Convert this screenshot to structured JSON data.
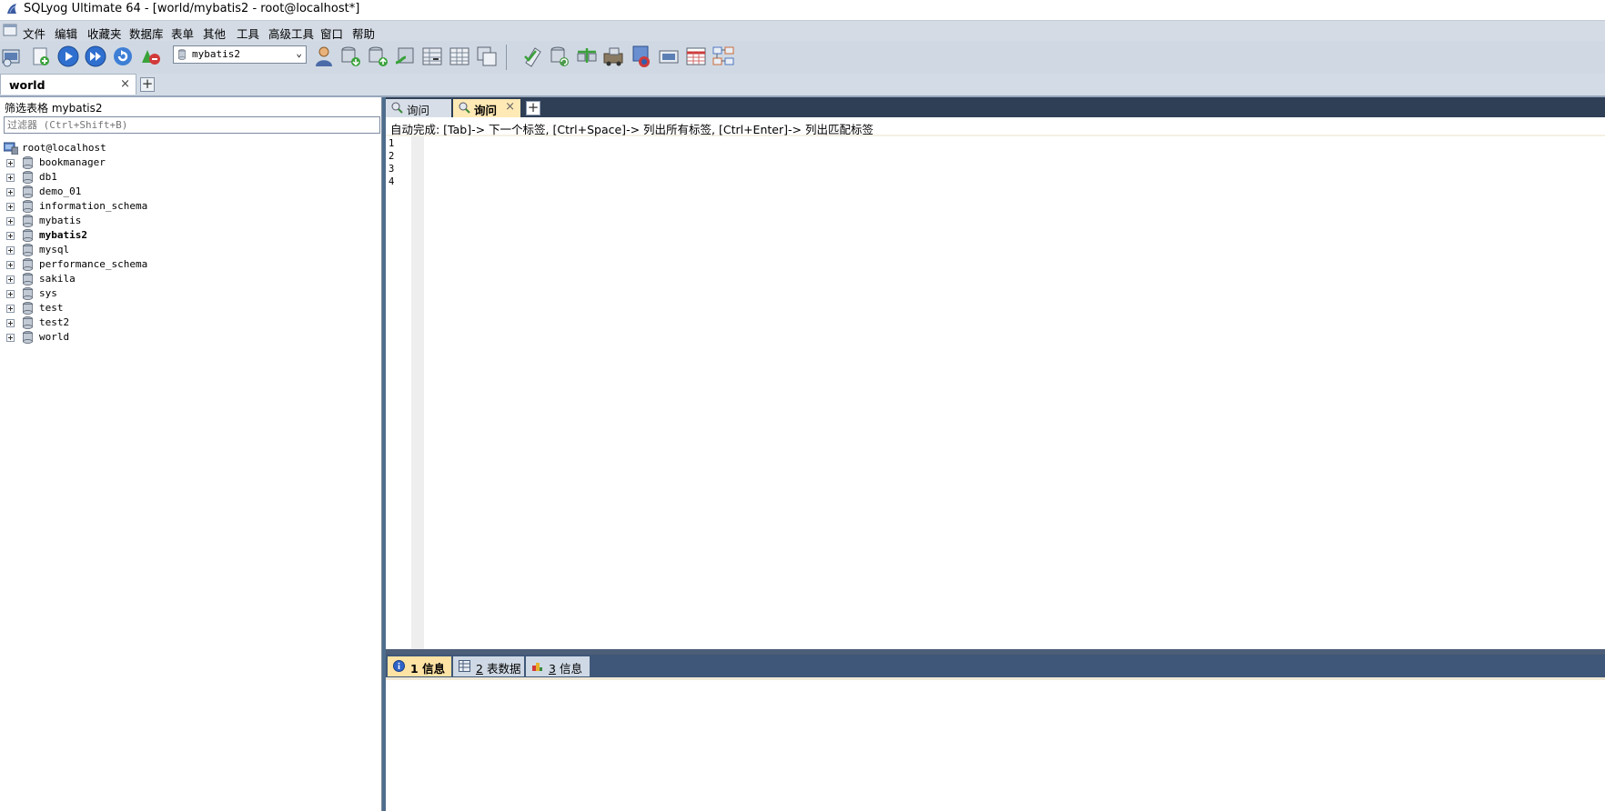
{
  "window": {
    "title": "SQLyog Ultimate 64 - [world/mybatis2 - root@localhost*]"
  },
  "menu": [
    {
      "label": "文件"
    },
    {
      "label": "编辑"
    },
    {
      "label": "收藏夹"
    },
    {
      "label": "数据库"
    },
    {
      "label": "表单"
    },
    {
      "label": "其他"
    },
    {
      "label": "工具"
    },
    {
      "label": "高级工具"
    },
    {
      "label": "窗口"
    },
    {
      "label": "帮助"
    }
  ],
  "toolbar": {
    "database_selector": {
      "value": "mybatis2"
    },
    "icons": [
      "new-connection-icon",
      "new-query-icon",
      "execute-query-icon",
      "execute-all-icon",
      "refresh-icon",
      "stop-icon",
      "user-manager-icon",
      "backup-db-icon",
      "restore-db-icon",
      "import-icon",
      "export-table-icon",
      "table-data-icon",
      "copy-table-icon",
      "schema-sync-icon",
      "data-sync-icon",
      "import-external-icon",
      "scheduled-backup-icon",
      "query-builder-icon",
      "schema-designer-icon",
      "report-icon",
      "sql-formatter-icon"
    ]
  },
  "connection_tabs": [
    {
      "label": "world",
      "close": "×"
    }
  ],
  "object_browser": {
    "filter_label": "筛选表格 mybatis2",
    "filter_placeholder": "过滤器 (Ctrl+Shift+B)",
    "root": "root@localhost",
    "databases": [
      {
        "name": "bookmanager",
        "selected": false
      },
      {
        "name": "db1",
        "selected": false
      },
      {
        "name": "demo_01",
        "selected": false
      },
      {
        "name": "information_schema",
        "selected": false
      },
      {
        "name": "mybatis",
        "selected": false
      },
      {
        "name": "mybatis2",
        "selected": true
      },
      {
        "name": "mysql",
        "selected": false
      },
      {
        "name": "performance_schema",
        "selected": false
      },
      {
        "name": "sakila",
        "selected": false
      },
      {
        "name": "sys",
        "selected": false
      },
      {
        "name": "test",
        "selected": false
      },
      {
        "name": "test2",
        "selected": false
      },
      {
        "name": "world",
        "selected": false
      }
    ]
  },
  "query_tabs": [
    {
      "label": "询问",
      "active": false
    },
    {
      "label": "询问",
      "active": true,
      "close": "×"
    }
  ],
  "editor": {
    "autocomplete_hint": "自动完成: [Tab]-> 下一个标签, [Ctrl+Space]-> 列出所有标签, [Ctrl+Enter]-> 列出匹配标签",
    "line_numbers": [
      "1",
      "2",
      "3",
      "4"
    ]
  },
  "result_tabs": [
    {
      "num": "1",
      "label": "信息",
      "active": true
    },
    {
      "num": "2",
      "label": "表数据",
      "active": false
    },
    {
      "num": "3",
      "label": "信息",
      "active": false
    }
  ],
  "colors": {
    "menubar_bg": "#d4dbe4",
    "tab_active": "#ffe9b5",
    "tabstrip_dark": "#2e3f56",
    "results_strip": "#3f5778"
  }
}
